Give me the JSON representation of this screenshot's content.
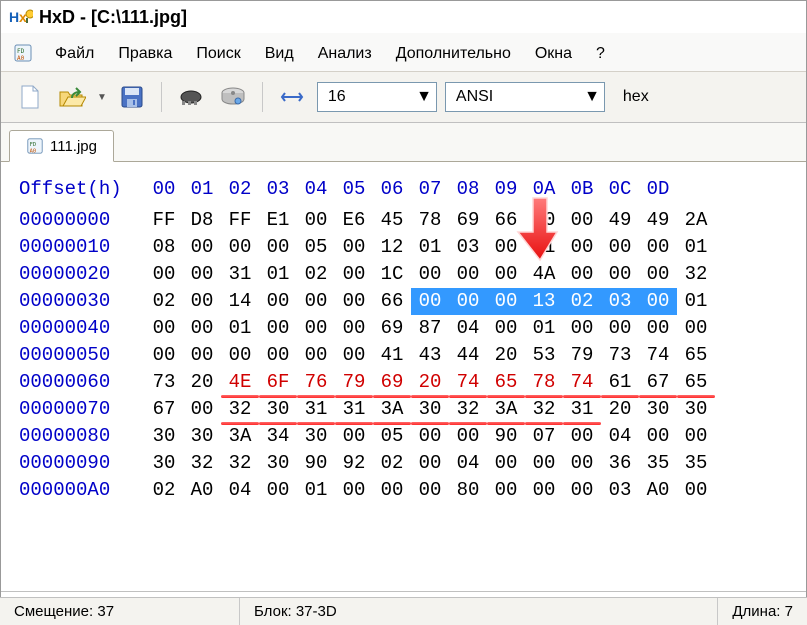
{
  "app": {
    "title": "HxD - [C:\\111.jpg]"
  },
  "menu": {
    "file": "Файл",
    "edit": "Правка",
    "search": "Поиск",
    "view": "Вид",
    "analysis": "Анализ",
    "extras": "Дополнительно",
    "window": "Окна",
    "help": "?"
  },
  "toolbar": {
    "bytes_per_row": "16",
    "charset": "ANSI",
    "base": "hex"
  },
  "tab": {
    "label": "111.jpg"
  },
  "hex": {
    "offset_label": "Offset(h)",
    "columns": [
      "00",
      "01",
      "02",
      "03",
      "04",
      "05",
      "06",
      "07",
      "08",
      "09",
      "0A",
      "0B",
      "0C",
      "0D"
    ],
    "rows": [
      {
        "off": "00000000",
        "b": [
          "FF",
          "D8",
          "FF",
          "E1",
          "00",
          "E6",
          "45",
          "78",
          "69",
          "66",
          "00",
          "00",
          "49",
          "49",
          "2A"
        ]
      },
      {
        "off": "00000010",
        "b": [
          "08",
          "00",
          "00",
          "00",
          "05",
          "00",
          "12",
          "01",
          "03",
          "00",
          "01",
          "00",
          "00",
          "00",
          "01"
        ]
      },
      {
        "off": "00000020",
        "b": [
          "00",
          "00",
          "31",
          "01",
          "02",
          "00",
          "1C",
          "00",
          "00",
          "00",
          "4A",
          "00",
          "00",
          "00",
          "32"
        ]
      },
      {
        "off": "00000030",
        "b": [
          "02",
          "00",
          "14",
          "00",
          "00",
          "00",
          "66",
          "00",
          "00",
          "00",
          "13",
          "02",
          "03",
          "00",
          "01"
        ]
      },
      {
        "off": "00000040",
        "b": [
          "00",
          "00",
          "01",
          "00",
          "00",
          "00",
          "69",
          "87",
          "04",
          "00",
          "01",
          "00",
          "00",
          "00",
          "00"
        ]
      },
      {
        "off": "00000050",
        "b": [
          "00",
          "00",
          "00",
          "00",
          "00",
          "00",
          "41",
          "43",
          "44",
          "20",
          "53",
          "79",
          "73",
          "74",
          "65"
        ]
      },
      {
        "off": "00000060",
        "b": [
          "73",
          "20",
          "4E",
          "6F",
          "76",
          "79",
          "69",
          "20",
          "74",
          "65",
          "78",
          "74",
          "61",
          "67",
          "65"
        ]
      },
      {
        "off": "00000070",
        "b": [
          "67",
          "00",
          "32",
          "30",
          "31",
          "31",
          "3A",
          "30",
          "32",
          "3A",
          "32",
          "31",
          "20",
          "30",
          "30"
        ]
      },
      {
        "off": "00000080",
        "b": [
          "30",
          "30",
          "3A",
          "34",
          "30",
          "00",
          "05",
          "00",
          "00",
          "90",
          "07",
          "00",
          "04",
          "00",
          "00"
        ]
      },
      {
        "off": "00000090",
        "b": [
          "30",
          "32",
          "32",
          "30",
          "90",
          "92",
          "02",
          "00",
          "04",
          "00",
          "00",
          "00",
          "36",
          "35",
          "35"
        ]
      },
      {
        "off": "000000A0",
        "b": [
          "02",
          "A0",
          "04",
          "00",
          "01",
          "00",
          "00",
          "00",
          "80",
          "00",
          "00",
          "00",
          "03",
          "A0",
          "00"
        ]
      }
    ],
    "selection": {
      "row": 3,
      "from": 7,
      "to": 13
    },
    "red_cells": {
      "row": 6,
      "from": 2,
      "to": 11
    },
    "underline_rows": [
      {
        "row": 6,
        "from": 2,
        "to": 14
      },
      {
        "row": 7,
        "from": 2,
        "to": 11
      }
    ]
  },
  "status": {
    "offset_label": "Смещение:",
    "offset_value": "37",
    "block_label": "Блок:",
    "block_value": "37-3D",
    "length_label": "Длина:",
    "length_value": "7"
  }
}
